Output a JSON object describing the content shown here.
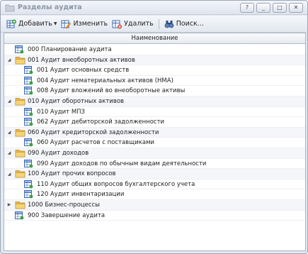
{
  "window": {
    "title": "Разделы аудита",
    "controls": [
      "?",
      "_",
      "□",
      "✕"
    ]
  },
  "toolbar": {
    "add_label": "Добавить",
    "edit_label": "Изменить",
    "delete_label": "Удалить",
    "search_label": "Поиск..."
  },
  "grid": {
    "column_header": "Наименование",
    "rows": [
      {
        "label": "000 Планирование аудита",
        "kind": "leaf",
        "level": 0
      },
      {
        "label": "001 Аудит внеоборотных активов",
        "kind": "folder",
        "level": 0,
        "expanded": true
      },
      {
        "label": "001 Аудит основных средств",
        "kind": "leaf",
        "level": 1
      },
      {
        "label": "004 Аудит нематериальных активов (НМА)",
        "kind": "leaf",
        "level": 1
      },
      {
        "label": "008 Аудит вложений во внеоборотные активы",
        "kind": "leaf",
        "level": 1
      },
      {
        "label": "010 Аудит оборотных активов",
        "kind": "folder",
        "level": 0,
        "expanded": true
      },
      {
        "label": "010 Аудит МПЗ",
        "kind": "leaf",
        "level": 1
      },
      {
        "label": "062 Аудит дебиторской задолженности",
        "kind": "leaf",
        "level": 1
      },
      {
        "label": "060 Аудит кредиторской задолженности",
        "kind": "folder",
        "level": 0,
        "expanded": true
      },
      {
        "label": "060 Аудит расчетов с поставщиками",
        "kind": "leaf",
        "level": 1
      },
      {
        "label": "090 Аудит доходов",
        "kind": "folder",
        "level": 0,
        "expanded": true
      },
      {
        "label": "090 Аудит доходов по обычным видам деятельности",
        "kind": "leaf",
        "level": 1
      },
      {
        "label": "100 Аудит прочих вопросов",
        "kind": "folder",
        "level": 0,
        "expanded": true
      },
      {
        "label": "110 Аудит общих вопросов бухгалтерского учета",
        "kind": "leaf",
        "level": 1
      },
      {
        "label": "120 Аудит инвентаризации",
        "kind": "leaf",
        "level": 1
      },
      {
        "label": "1000 Бизнес-процессы",
        "kind": "folder",
        "level": 0,
        "expanded": false
      },
      {
        "label": "900 Завершение аудита",
        "kind": "leaf",
        "level": 0
      }
    ]
  },
  "colors": {
    "folder": "#e9b94a",
    "leaf_icon_blue": "#3a68b4",
    "group_row_bg": "#f4f6fa"
  }
}
